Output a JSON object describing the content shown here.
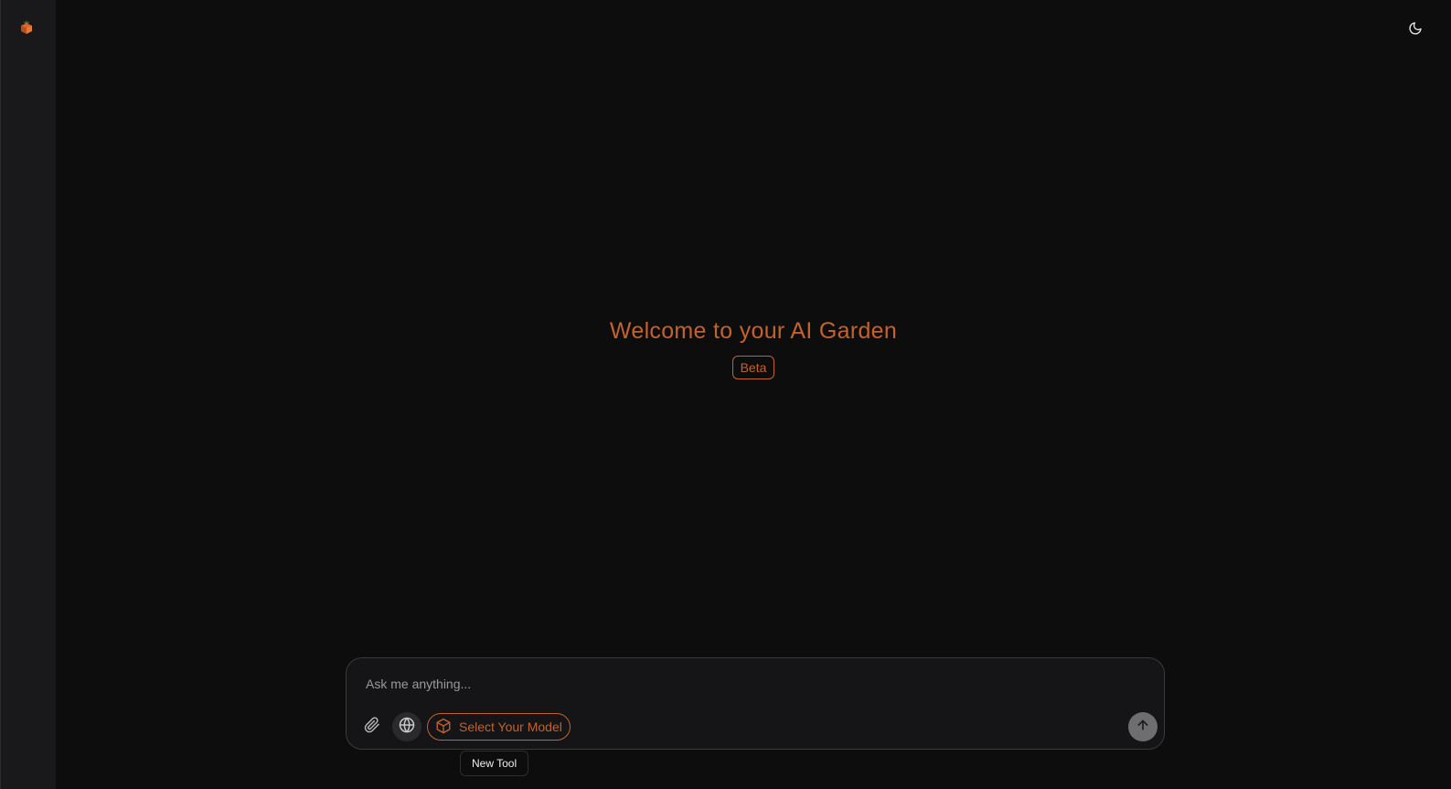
{
  "app": {
    "logo_icon": "fruit-logo-icon",
    "theme_toggle_icon": "moon-icon"
  },
  "hero": {
    "title": "Welcome to your AI Garden",
    "badge": "Beta"
  },
  "composer": {
    "placeholder": "Ask me anything...",
    "attach_icon": "paperclip-icon",
    "web_icon": "globe-icon",
    "model_icon": "cube-icon",
    "model_label": "Select Your Model",
    "send_icon": "arrow-up-icon"
  },
  "tooltip": {
    "text": "New Tool"
  },
  "colors": {
    "accent": "#c4622d",
    "background": "#0d0d0e",
    "sidebar": "#19191b"
  }
}
